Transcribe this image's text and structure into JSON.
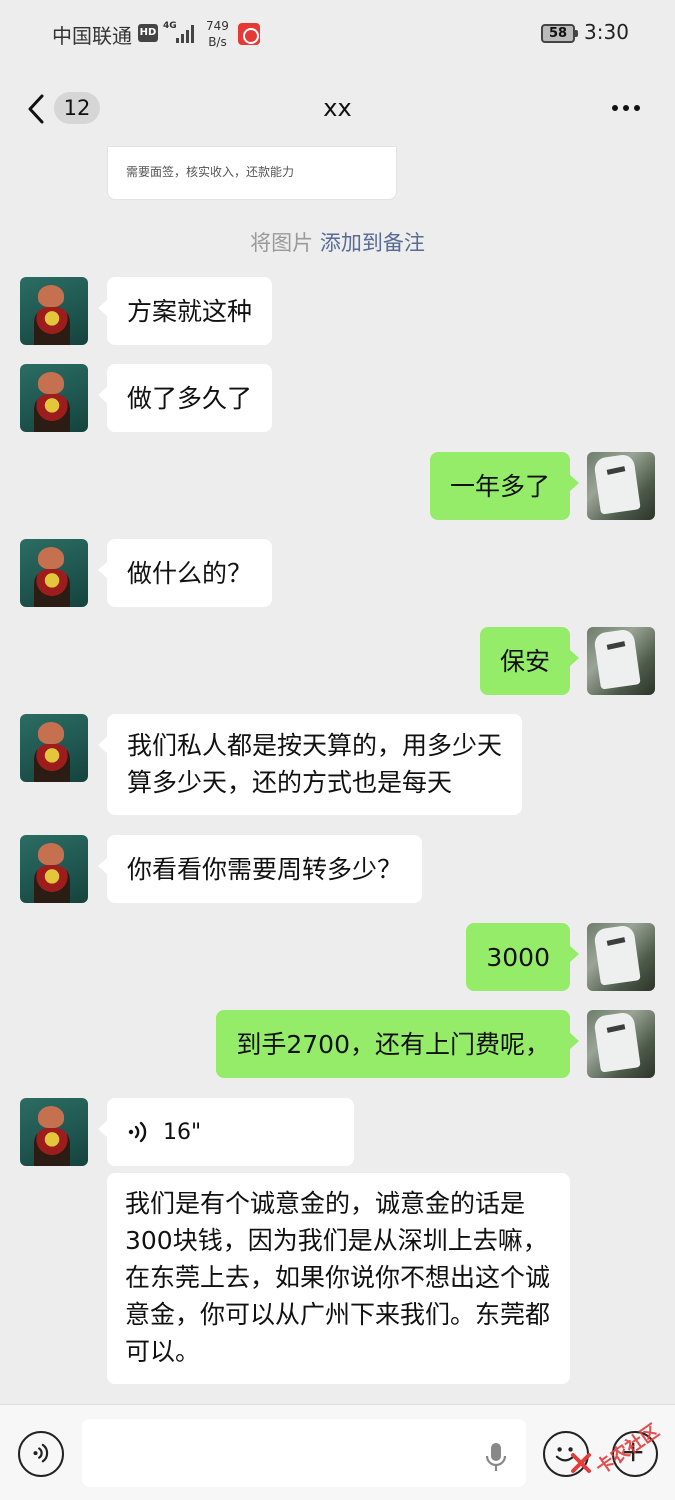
{
  "status_bar": {
    "carrier": "中国联通",
    "hd": "HD",
    "network": "4G",
    "speed_value": "749",
    "speed_unit": "B/s",
    "battery": "58",
    "time": "3:30"
  },
  "nav": {
    "unread_count": "12",
    "title": "xx"
  },
  "top_card": {
    "text": "需要面签，核实收入，还款能力"
  },
  "system_hint": {
    "prefix": "将图片",
    "link": "添加到备注"
  },
  "messages": [
    {
      "side": "left",
      "text": "方案就这种"
    },
    {
      "side": "left",
      "text": "做了多久了"
    },
    {
      "side": "right",
      "text": "一年多了"
    },
    {
      "side": "left",
      "text": "做什么的？"
    },
    {
      "side": "right",
      "text": "保安"
    },
    {
      "side": "left",
      "line1": "我们私人都是按天算的，用多少天",
      "line2": "算多少天，还的方式也是每天"
    },
    {
      "side": "left",
      "text": "你看看你需要周转多少？"
    },
    {
      "side": "right",
      "text": "3000"
    },
    {
      "side": "right",
      "text": "到手2700，还有上门费呢，"
    },
    {
      "side": "left",
      "type": "voice",
      "duration": "16\""
    },
    {
      "side": "left",
      "type": "transcript",
      "text": "我们是有个诚意金的，诚意金的话是300块钱，因为我们是从深圳上去嘛，在东莞上去，如果你说你不想出这个诚意金，你可以从广州下来我们。东莞都可以。"
    }
  ],
  "watermark": "卡农社区",
  "colors": {
    "background": "#ededed",
    "sent_bubble": "#95ec69",
    "received_bubble": "#ffffff",
    "link": "#576b95"
  }
}
